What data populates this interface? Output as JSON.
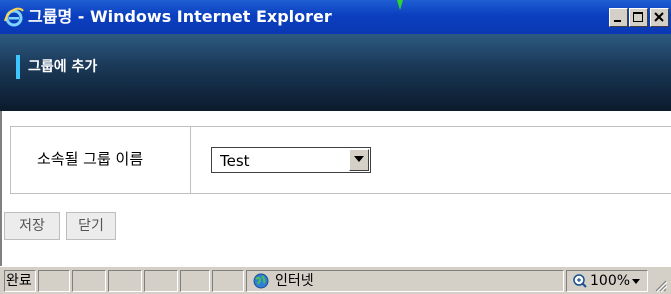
{
  "window": {
    "title": "그룹명 - Windows Internet Explorer",
    "icon": "ie-icon",
    "controls": [
      "minimize-icon",
      "maximize-icon",
      "close-icon"
    ]
  },
  "page": {
    "header_title": "그룹에 추가",
    "form": {
      "label": "소속될 그룹 이름",
      "group_select": {
        "value": "Test"
      }
    },
    "buttons": {
      "save": "저장",
      "close": "닫기"
    }
  },
  "statusbar": {
    "status_text": "완료",
    "zone_text": "인터넷",
    "zoom_text": "100%",
    "icons": [
      "globe-icon",
      "zoom-icon",
      "chevron-down-icon",
      "resize-grip-icon"
    ]
  },
  "colors": {
    "titlebar": "#0a3fbf",
    "header_band": "#1b3a59",
    "accent": "#3ec7ff",
    "status_bg": "#d4d0c8"
  }
}
